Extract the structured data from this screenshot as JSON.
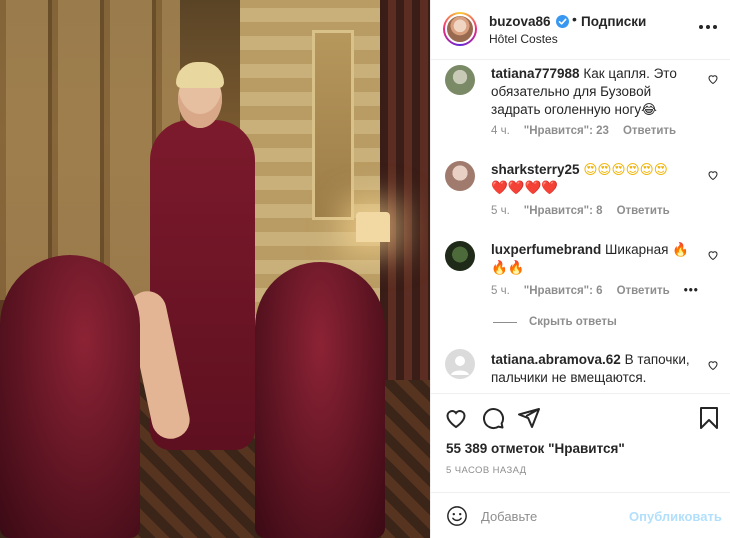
{
  "post": {
    "image_alt": "photo",
    "header": {
      "username": "buzova86",
      "separator": "•",
      "follow_label": "Подписки",
      "location": "Hôtel Costes"
    },
    "comments": [
      {
        "username": "tatiana777988",
        "text": "Как цапля. Это обязательно для Бузовой задрать оголенную ногу😂",
        "time": "4 ч.",
        "likes": "\"Нравится\": 23",
        "reply": "Ответить"
      },
      {
        "username": "sharksterry25",
        "text": "😍😍😍😍😍😍",
        "text2": "❤️❤️❤️❤️",
        "time": "5 ч.",
        "likes": "\"Нравится\": 8",
        "reply": "Ответить"
      },
      {
        "username": "luxperfumebrand",
        "text": "Шикарная 🔥",
        "text2": "🔥🔥",
        "time": "5 ч.",
        "likes": "\"Нравится\": 6",
        "reply": "Ответить"
      },
      {
        "username": "tatiana.abramova.62",
        "text": "В тапочки, пальчики не вмещаются."
      }
    ],
    "hide_replies": "Скрыть ответы",
    "likes_count": "55 389 отметок \"Нравится\"",
    "time_ago": "5 ЧАСОВ НАЗАД",
    "add_comment": {
      "placeholder": "Добавьте",
      "publish_label": "Опубликовать"
    }
  },
  "icons": {
    "verified": "verified-badge-icon",
    "more": "more-options-icon",
    "like": "heart-icon",
    "comment": "comment-bubble-icon",
    "share": "paper-plane-icon",
    "save": "bookmark-icon",
    "emoji": "smile-icon"
  },
  "colors": {
    "verified": "#3897f0",
    "muted": "#8e8e8e",
    "publish_disabled": "#b2dffc",
    "text": "#262626"
  }
}
